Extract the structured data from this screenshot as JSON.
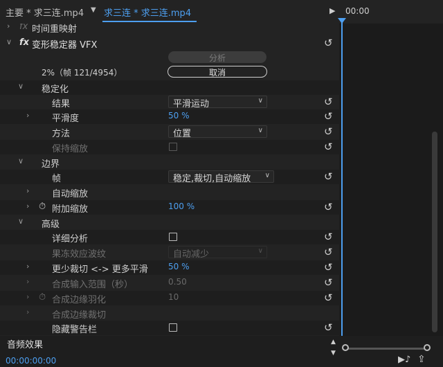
{
  "tabs": {
    "main_tab": "主要 * 求三连.mp4",
    "active_tab": "求三连 * 求三连.mp4",
    "timecode_start": "00:00"
  },
  "effect": {
    "prev_item": "时间重映射",
    "name": "变形稳定器 VFX",
    "analyze_button": "分析",
    "progress_text": "2%（帧 121/4954）",
    "cancel_button": "取消"
  },
  "sections": {
    "stabilization": "稳定化",
    "borders": "边界",
    "advanced": "高级"
  },
  "params": {
    "result": {
      "label": "结果",
      "value": "平滑运动"
    },
    "smoothness": {
      "label": "平滑度",
      "value": "50 %"
    },
    "method": {
      "label": "方法",
      "value": "位置"
    },
    "preserve_scale": {
      "label": "保持缩放"
    },
    "framing": {
      "label": "帧",
      "value": "稳定,裁切,自动缩放"
    },
    "auto_scale": {
      "label": "自动缩放"
    },
    "additional_scale": {
      "label": "附加缩放",
      "value": "100 %"
    },
    "detailed_analysis": {
      "label": "详细分析"
    },
    "rolling_shutter": {
      "label": "果冻效应波纹",
      "value": "自动减少"
    },
    "crop_less_smooth_more": {
      "label": "更少裁切 <-> 更多平滑",
      "value": "50 %"
    },
    "synth_input_range": {
      "label": "合成输入范围（秒）",
      "value": "0.50"
    },
    "synth_edge_feather": {
      "label": "合成边缘羽化",
      "value": "10"
    },
    "synth_edge_crop": {
      "label": "合成边缘裁切"
    },
    "hide_warning": {
      "label": "隐藏警告栏"
    }
  },
  "bottom": {
    "audio_effects": "音频效果",
    "timecode": "00:00:00:00"
  },
  "colors": {
    "accent": "#4d9ff0",
    "panel_bg": "#232323",
    "timeline_bg": "#1b1b1b"
  },
  "icons": [
    "fx-icon",
    "reset-icon",
    "chevron-down-icon",
    "chevron-right-icon",
    "stopwatch-icon",
    "play-icon",
    "export-icon",
    "audio-play-icon"
  ]
}
